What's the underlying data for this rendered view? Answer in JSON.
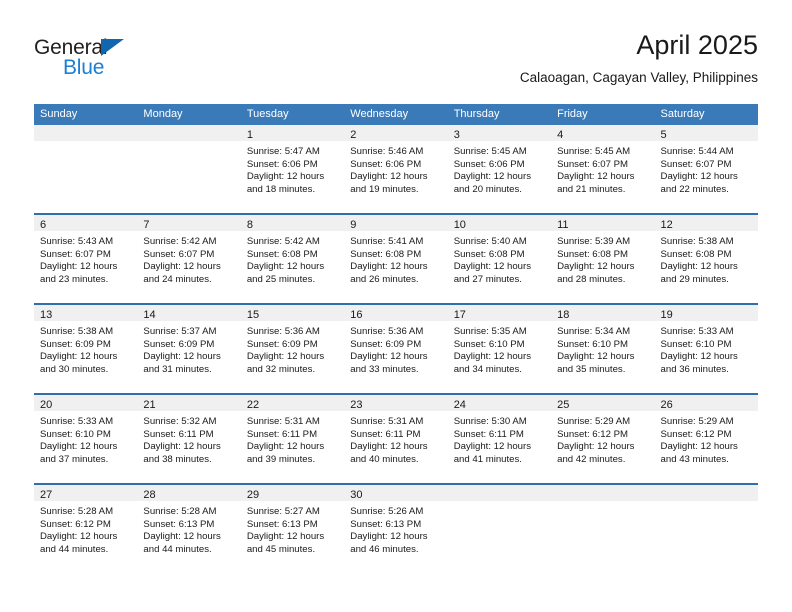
{
  "brand": {
    "name_part1": "General",
    "name_part2": "Blue",
    "triangle_color": "#1067b0",
    "blue_text_color": "#1c7fd4"
  },
  "header": {
    "title": "April 2025",
    "subtitle": "Calaoagan, Cagayan Valley, Philippines"
  },
  "theme": {
    "header_blue": "#3b7ab8",
    "row_divider_blue": "#2f6fab",
    "daynum_strip": "#f0f0f0"
  },
  "weekdays": [
    "Sunday",
    "Monday",
    "Tuesday",
    "Wednesday",
    "Thursday",
    "Friday",
    "Saturday"
  ],
  "weeks": [
    [
      {
        "day": "",
        "lines": []
      },
      {
        "day": "",
        "lines": []
      },
      {
        "day": "1",
        "lines": [
          "Sunrise: 5:47 AM",
          "Sunset: 6:06 PM",
          "Daylight: 12 hours",
          "and 18 minutes."
        ]
      },
      {
        "day": "2",
        "lines": [
          "Sunrise: 5:46 AM",
          "Sunset: 6:06 PM",
          "Daylight: 12 hours",
          "and 19 minutes."
        ]
      },
      {
        "day": "3",
        "lines": [
          "Sunrise: 5:45 AM",
          "Sunset: 6:06 PM",
          "Daylight: 12 hours",
          "and 20 minutes."
        ]
      },
      {
        "day": "4",
        "lines": [
          "Sunrise: 5:45 AM",
          "Sunset: 6:07 PM",
          "Daylight: 12 hours",
          "and 21 minutes."
        ]
      },
      {
        "day": "5",
        "lines": [
          "Sunrise: 5:44 AM",
          "Sunset: 6:07 PM",
          "Daylight: 12 hours",
          "and 22 minutes."
        ]
      }
    ],
    [
      {
        "day": "6",
        "lines": [
          "Sunrise: 5:43 AM",
          "Sunset: 6:07 PM",
          "Daylight: 12 hours",
          "and 23 minutes."
        ]
      },
      {
        "day": "7",
        "lines": [
          "Sunrise: 5:42 AM",
          "Sunset: 6:07 PM",
          "Daylight: 12 hours",
          "and 24 minutes."
        ]
      },
      {
        "day": "8",
        "lines": [
          "Sunrise: 5:42 AM",
          "Sunset: 6:08 PM",
          "Daylight: 12 hours",
          "and 25 minutes."
        ]
      },
      {
        "day": "9",
        "lines": [
          "Sunrise: 5:41 AM",
          "Sunset: 6:08 PM",
          "Daylight: 12 hours",
          "and 26 minutes."
        ]
      },
      {
        "day": "10",
        "lines": [
          "Sunrise: 5:40 AM",
          "Sunset: 6:08 PM",
          "Daylight: 12 hours",
          "and 27 minutes."
        ]
      },
      {
        "day": "11",
        "lines": [
          "Sunrise: 5:39 AM",
          "Sunset: 6:08 PM",
          "Daylight: 12 hours",
          "and 28 minutes."
        ]
      },
      {
        "day": "12",
        "lines": [
          "Sunrise: 5:38 AM",
          "Sunset: 6:08 PM",
          "Daylight: 12 hours",
          "and 29 minutes."
        ]
      }
    ],
    [
      {
        "day": "13",
        "lines": [
          "Sunrise: 5:38 AM",
          "Sunset: 6:09 PM",
          "Daylight: 12 hours",
          "and 30 minutes."
        ]
      },
      {
        "day": "14",
        "lines": [
          "Sunrise: 5:37 AM",
          "Sunset: 6:09 PM",
          "Daylight: 12 hours",
          "and 31 minutes."
        ]
      },
      {
        "day": "15",
        "lines": [
          "Sunrise: 5:36 AM",
          "Sunset: 6:09 PM",
          "Daylight: 12 hours",
          "and 32 minutes."
        ]
      },
      {
        "day": "16",
        "lines": [
          "Sunrise: 5:36 AM",
          "Sunset: 6:09 PM",
          "Daylight: 12 hours",
          "and 33 minutes."
        ]
      },
      {
        "day": "17",
        "lines": [
          "Sunrise: 5:35 AM",
          "Sunset: 6:10 PM",
          "Daylight: 12 hours",
          "and 34 minutes."
        ]
      },
      {
        "day": "18",
        "lines": [
          "Sunrise: 5:34 AM",
          "Sunset: 6:10 PM",
          "Daylight: 12 hours",
          "and 35 minutes."
        ]
      },
      {
        "day": "19",
        "lines": [
          "Sunrise: 5:33 AM",
          "Sunset: 6:10 PM",
          "Daylight: 12 hours",
          "and 36 minutes."
        ]
      }
    ],
    [
      {
        "day": "20",
        "lines": [
          "Sunrise: 5:33 AM",
          "Sunset: 6:10 PM",
          "Daylight: 12 hours",
          "and 37 minutes."
        ]
      },
      {
        "day": "21",
        "lines": [
          "Sunrise: 5:32 AM",
          "Sunset: 6:11 PM",
          "Daylight: 12 hours",
          "and 38 minutes."
        ]
      },
      {
        "day": "22",
        "lines": [
          "Sunrise: 5:31 AM",
          "Sunset: 6:11 PM",
          "Daylight: 12 hours",
          "and 39 minutes."
        ]
      },
      {
        "day": "23",
        "lines": [
          "Sunrise: 5:31 AM",
          "Sunset: 6:11 PM",
          "Daylight: 12 hours",
          "and 40 minutes."
        ]
      },
      {
        "day": "24",
        "lines": [
          "Sunrise: 5:30 AM",
          "Sunset: 6:11 PM",
          "Daylight: 12 hours",
          "and 41 minutes."
        ]
      },
      {
        "day": "25",
        "lines": [
          "Sunrise: 5:29 AM",
          "Sunset: 6:12 PM",
          "Daylight: 12 hours",
          "and 42 minutes."
        ]
      },
      {
        "day": "26",
        "lines": [
          "Sunrise: 5:29 AM",
          "Sunset: 6:12 PM",
          "Daylight: 12 hours",
          "and 43 minutes."
        ]
      }
    ],
    [
      {
        "day": "27",
        "lines": [
          "Sunrise: 5:28 AM",
          "Sunset: 6:12 PM",
          "Daylight: 12 hours",
          "and 44 minutes."
        ]
      },
      {
        "day": "28",
        "lines": [
          "Sunrise: 5:28 AM",
          "Sunset: 6:13 PM",
          "Daylight: 12 hours",
          "and 44 minutes."
        ]
      },
      {
        "day": "29",
        "lines": [
          "Sunrise: 5:27 AM",
          "Sunset: 6:13 PM",
          "Daylight: 12 hours",
          "and 45 minutes."
        ]
      },
      {
        "day": "30",
        "lines": [
          "Sunrise: 5:26 AM",
          "Sunset: 6:13 PM",
          "Daylight: 12 hours",
          "and 46 minutes."
        ]
      },
      {
        "day": "",
        "lines": []
      },
      {
        "day": "",
        "lines": []
      },
      {
        "day": "",
        "lines": []
      }
    ]
  ]
}
